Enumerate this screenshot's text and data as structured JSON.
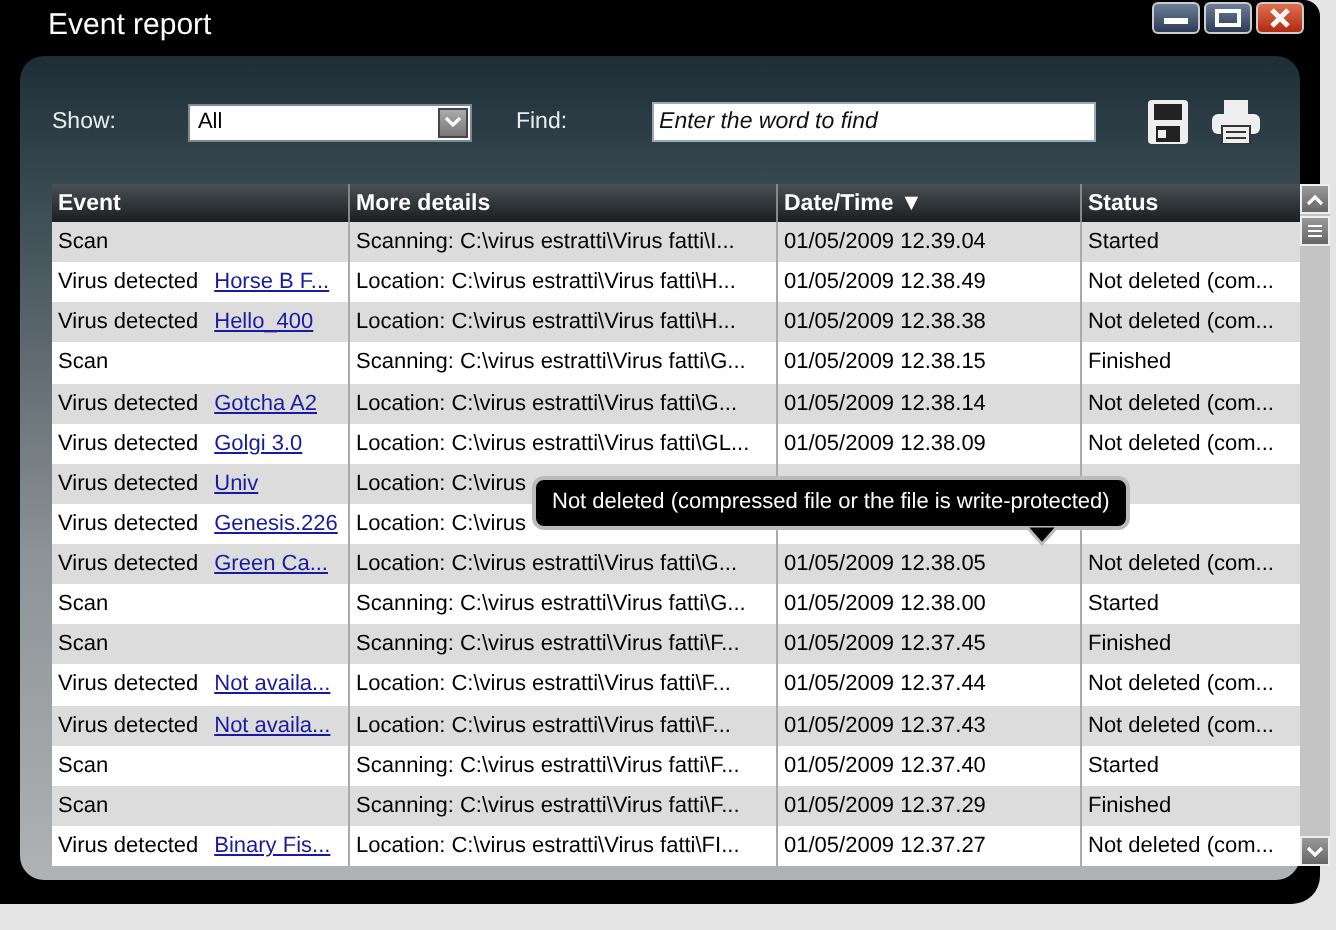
{
  "window": {
    "title": "Event report"
  },
  "filters": {
    "show_label": "Show:",
    "show_value": "All",
    "find_label": "Find:",
    "find_placeholder": "Enter the word to find"
  },
  "table": {
    "columns": [
      {
        "label": "Event"
      },
      {
        "label": "More details"
      },
      {
        "label": "Date/Time",
        "sort_indicator": "▼"
      },
      {
        "label": "Status"
      }
    ],
    "rows": [
      {
        "event": "Scan",
        "details": "Scanning: C:\\virus estratti\\Virus fatti\\I...",
        "datetime": "01/05/2009 12.39.04",
        "status": "Started"
      },
      {
        "event": "Virus detected",
        "name": "Horse B F...",
        "details": "Location: C:\\virus estratti\\Virus fatti\\H...",
        "datetime": "01/05/2009 12.38.49",
        "status": "Not deleted (com..."
      },
      {
        "event": "Virus detected",
        "name": "Hello_400",
        "details": "Location: C:\\virus estratti\\Virus fatti\\H...",
        "datetime": "01/05/2009 12.38.38",
        "status": "Not deleted (com..."
      },
      {
        "event": "Scan",
        "details": "Scanning: C:\\virus estratti\\Virus fatti\\G...",
        "datetime": "01/05/2009 12.38.15",
        "status": "Finished"
      },
      {
        "event": "Virus detected",
        "name": "Gotcha A2",
        "details": "Location: C:\\virus estratti\\Virus fatti\\G...",
        "datetime": "01/05/2009 12.38.14",
        "status": "Not deleted (com..."
      },
      {
        "event": "Virus detected",
        "name": "Golgi 3.0",
        "details": "Location: C:\\virus estratti\\Virus fatti\\GL...",
        "datetime": "01/05/2009 12.38.09",
        "status": "Not deleted (com..."
      },
      {
        "event": "Virus detected",
        "name": "Univ",
        "details": "Location: C:\\virus"
      },
      {
        "event": "Virus detected",
        "name": "Genesis.226",
        "details": "Location: C:\\virus"
      },
      {
        "event": "Virus detected",
        "name": "Green Ca...",
        "details": "Location: C:\\virus estratti\\Virus fatti\\G...",
        "datetime": "01/05/2009 12.38.05",
        "status": "Not deleted (com..."
      },
      {
        "event": "Scan",
        "details": "Scanning: C:\\virus estratti\\Virus fatti\\G...",
        "datetime": "01/05/2009 12.38.00",
        "status": "Started"
      },
      {
        "event": "Scan",
        "details": "Scanning: C:\\virus estratti\\Virus fatti\\F...",
        "datetime": "01/05/2009 12.37.45",
        "status": "Finished"
      },
      {
        "event": "Virus detected",
        "name": "Not availa...",
        "details": "Location: C:\\virus estratti\\Virus fatti\\F...",
        "datetime": "01/05/2009 12.37.44",
        "status": "Not deleted (com..."
      },
      {
        "event": "Virus detected",
        "name": "Not availa...",
        "details": "Location: C:\\virus estratti\\Virus fatti\\F...",
        "datetime": "01/05/2009 12.37.43",
        "status": "Not deleted (com..."
      },
      {
        "event": "Scan",
        "details": "Scanning: C:\\virus estratti\\Virus fatti\\F...",
        "datetime": "01/05/2009 12.37.40",
        "status": "Started"
      },
      {
        "event": "Scan",
        "details": "Scanning: C:\\virus estratti\\Virus fatti\\F...",
        "datetime": "01/05/2009 12.37.29",
        "status": "Finished"
      },
      {
        "event": "Virus detected",
        "name": "Binary Fis...",
        "details": "Location: C:\\virus estratti\\Virus fatti\\FI...",
        "datetime": "01/05/2009 12.37.27",
        "status": "Not deleted (com..."
      }
    ]
  },
  "tooltip": {
    "text": "Not deleted (compressed file or the file is write-protected)"
  }
}
